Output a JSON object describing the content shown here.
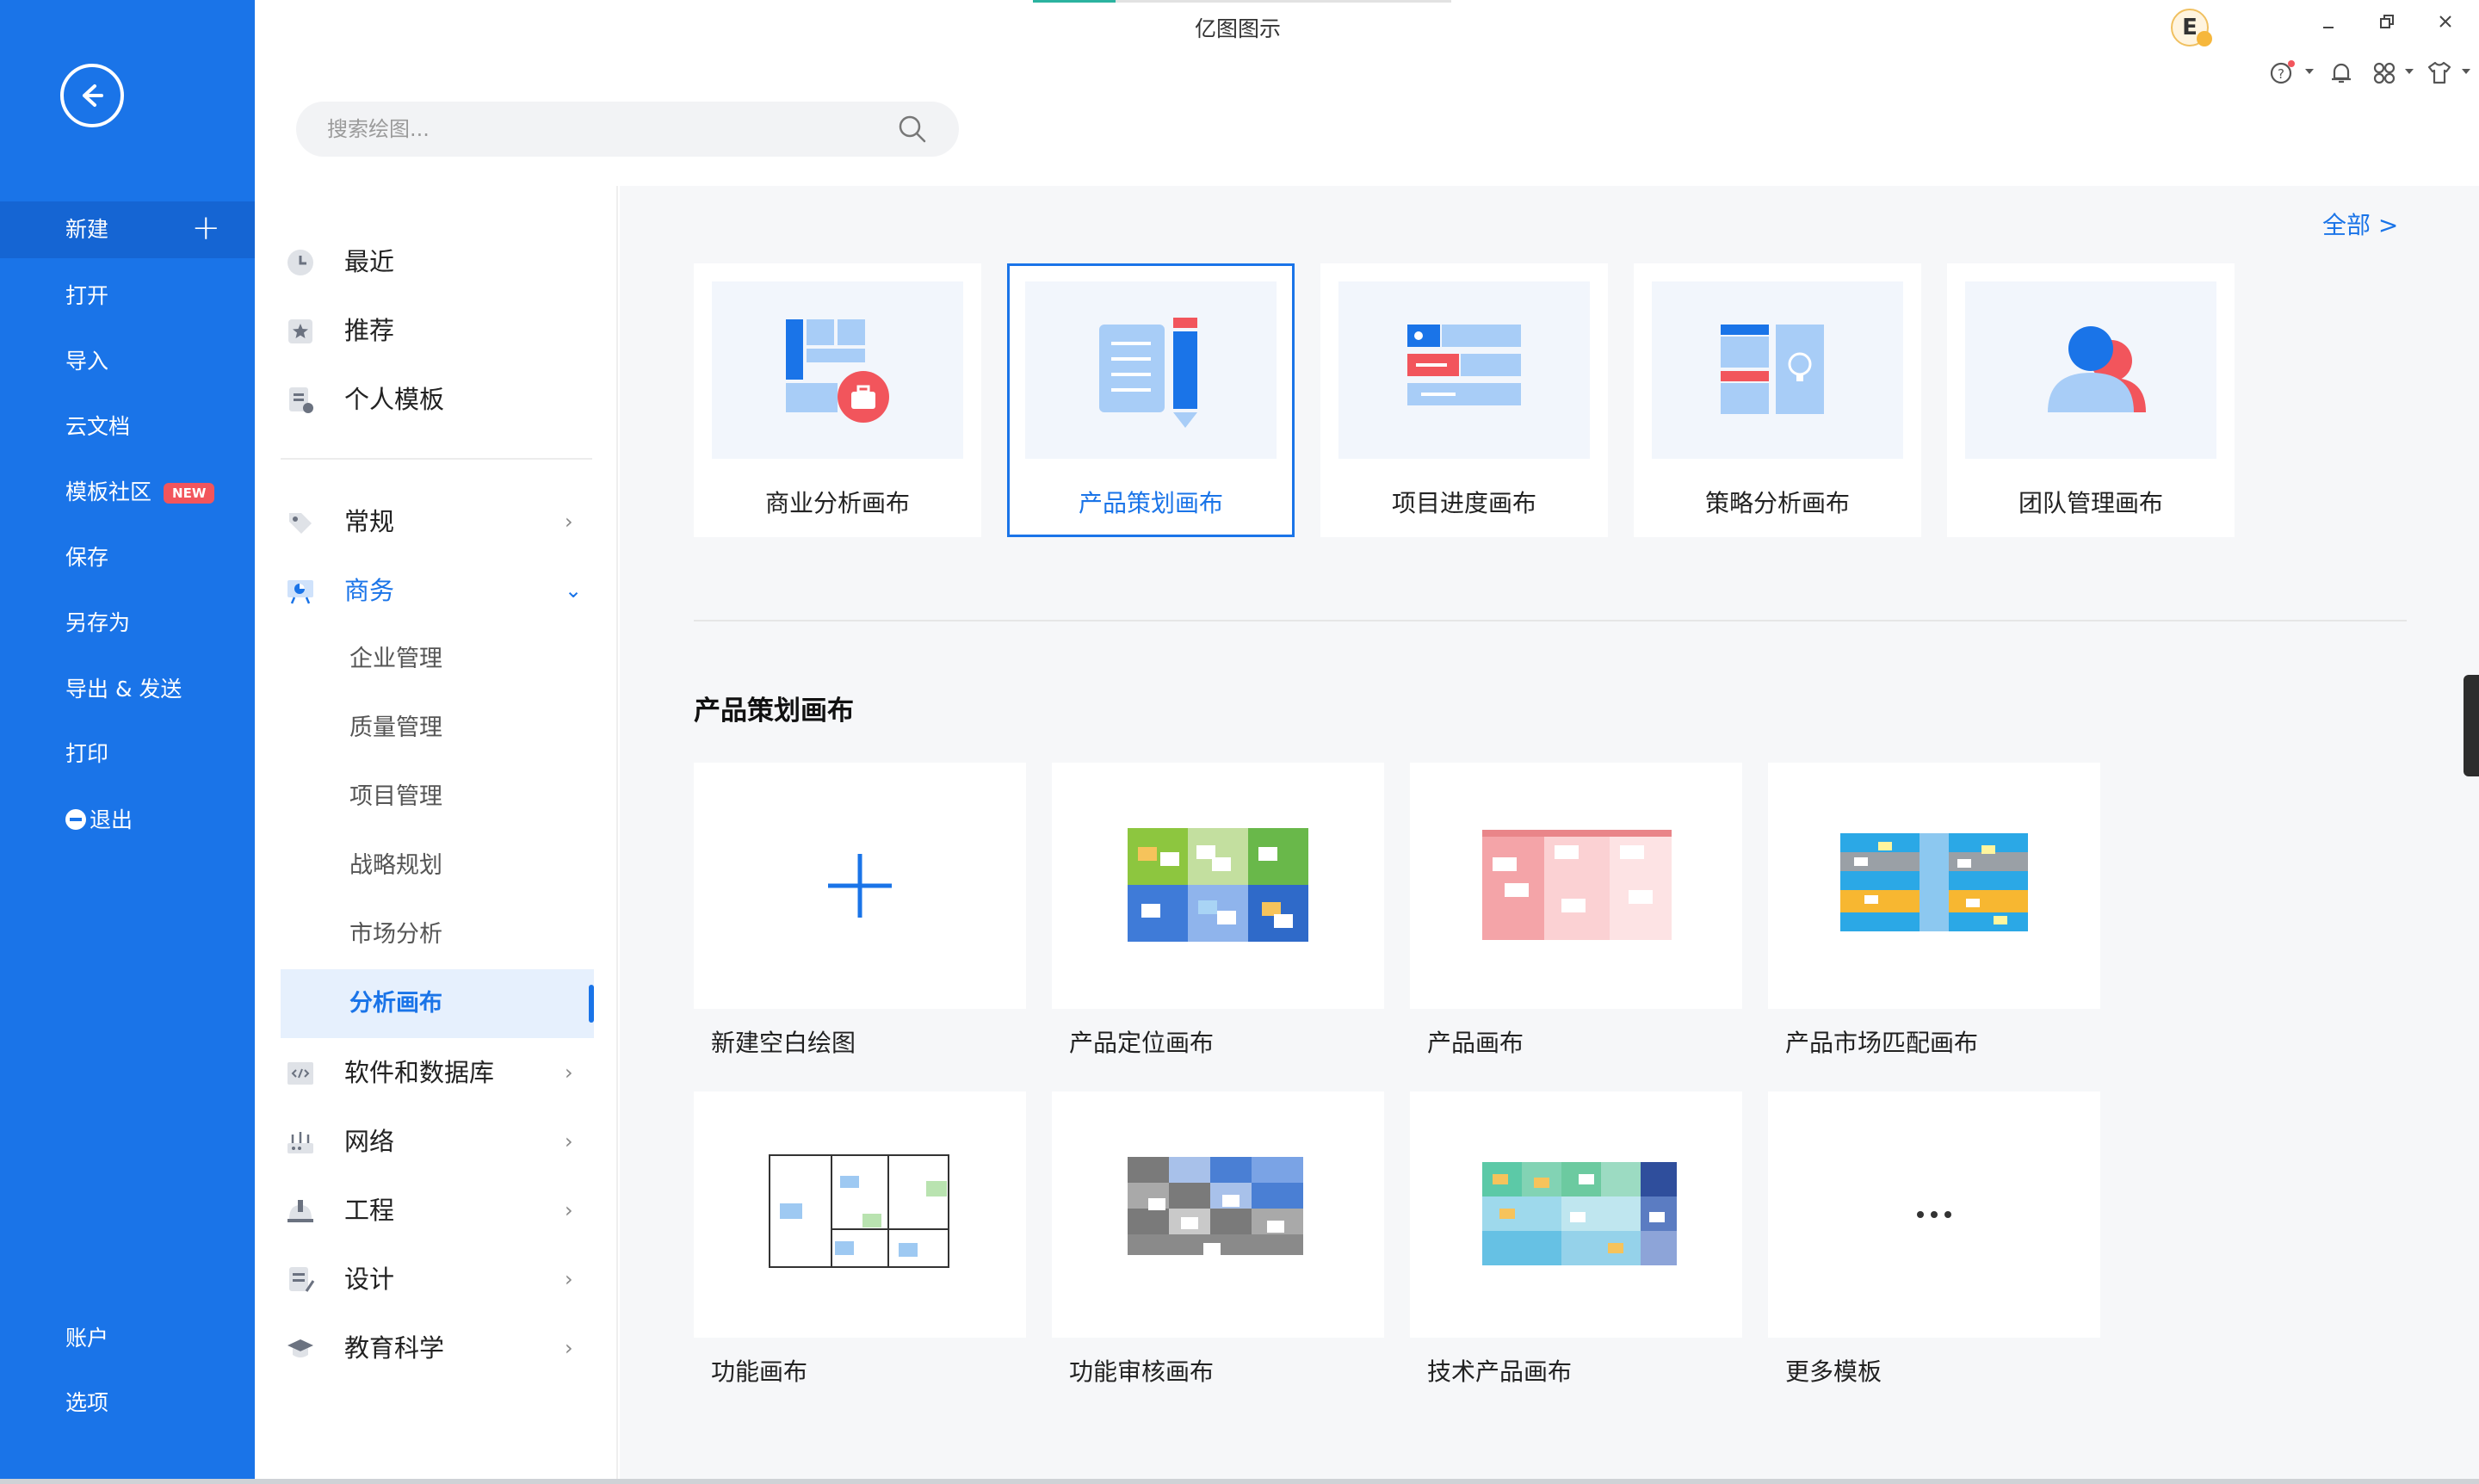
{
  "app": {
    "title": "亿图图示",
    "user_initial": "E"
  },
  "search": {
    "placeholder": "搜索绘图..."
  },
  "file_menu": {
    "new": "新建",
    "open": "打开",
    "import": "导入",
    "cloud": "云文档",
    "community": "模板社区",
    "community_badge": "NEW",
    "save": "保存",
    "save_as": "另存为",
    "export": "导出 & 发送",
    "print": "打印",
    "exit": "退出",
    "account": "账户",
    "options": "选项"
  },
  "categories": {
    "recent": "最近",
    "recommended": "推荐",
    "personal": "个人模板",
    "general": "常规",
    "business": "商务",
    "business_sub": [
      "企业管理",
      "质量管理",
      "项目管理",
      "战略规划",
      "市场分析",
      "分析画布"
    ],
    "software": "软件和数据库",
    "network": "网络",
    "engineering": "工程",
    "design": "设计",
    "education": "教育科学"
  },
  "main": {
    "view_all": "全部  >",
    "canvas_types": [
      {
        "label": "商业分析画布"
      },
      {
        "label": "产品策划画布"
      },
      {
        "label": "项目进度画布"
      },
      {
        "label": "策略分析画布"
      },
      {
        "label": "团队管理画布"
      }
    ],
    "section_title": "产品策划画布",
    "templates": [
      {
        "label": "新建空白绘图"
      },
      {
        "label": "产品定位画布"
      },
      {
        "label": "产品画布"
      },
      {
        "label": "产品市场匹配画布"
      },
      {
        "label": "功能画布"
      },
      {
        "label": "功能审核画布"
      },
      {
        "label": "技术产品画布"
      },
      {
        "label": "更多模板"
      }
    ]
  },
  "colors": {
    "accent": "#1a74e8",
    "sidebar": "#1a74e8",
    "selected_bg": "#e6f0fd"
  }
}
